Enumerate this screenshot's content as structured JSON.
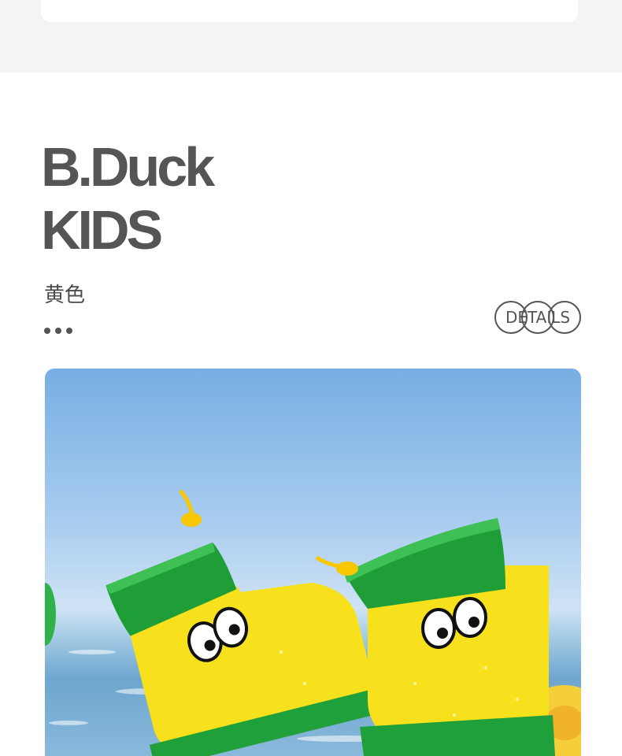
{
  "brand": {
    "line1": "B.Duck",
    "line2": "KIDS"
  },
  "product": {
    "color_label": "黄色"
  },
  "details_button": {
    "label": "DETAILS"
  },
  "icons": {
    "more": "more-dots-icon"
  },
  "colors": {
    "boot_yellow": "#f7e11c",
    "boot_green": "#20a03a",
    "text_gray": "#555555"
  }
}
